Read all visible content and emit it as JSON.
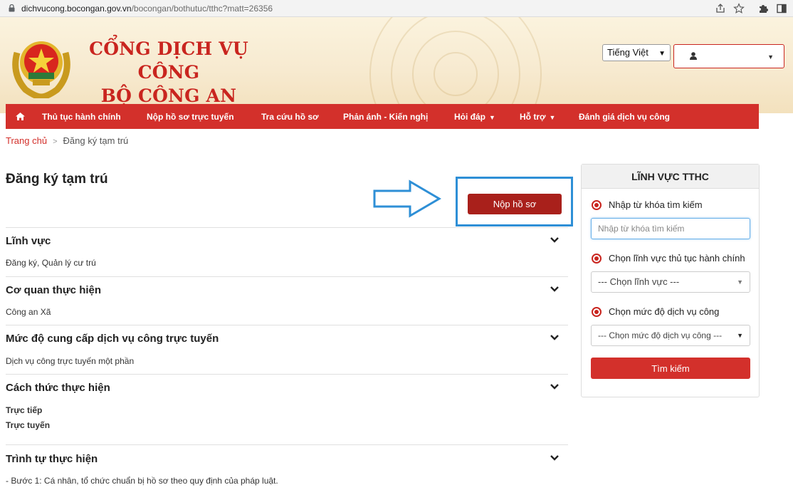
{
  "browser": {
    "url_domain": "dichvucong.bocongan.gov.vn",
    "url_path": "/bocongan/bothutuc/tthc?matt=26356"
  },
  "header": {
    "title_line1": "CỔNG DỊCH VỤ CÔNG",
    "title_line2": "BỘ CÔNG AN",
    "language": "Tiếng Việt"
  },
  "nav": {
    "items": [
      "Thủ tục hành chính",
      "Nộp hồ sơ trực tuyến",
      "Tra cứu hồ sơ",
      "Phản ánh - Kiến nghị",
      "Hỏi đáp",
      "Hỗ trợ",
      "Đánh giá dịch vụ công"
    ]
  },
  "breadcrumb": {
    "home": "Trang chủ",
    "separator": ">",
    "current": "Đăng ký tạm trú"
  },
  "main": {
    "title": "Đăng ký tạm trú",
    "submit_label": "Nộp hồ sơ",
    "sections": [
      {
        "title": "Lĩnh vực",
        "body": [
          "Đăng ký, Quản lý cư trú"
        ]
      },
      {
        "title": "Cơ quan thực hiện",
        "body": [
          "Công an Xã"
        ]
      },
      {
        "title": "Mức độ cung cấp dịch vụ công trực tuyến",
        "body": [
          "Dịch vụ công trực tuyến một phần"
        ]
      },
      {
        "title": "Cách thức thực hiện",
        "body": [
          "Trực tiếp",
          "Trực tuyến"
        ]
      },
      {
        "title": "Trình tự thực hiện",
        "body": [
          "- Bước 1: Cá nhân, tổ chức chuẩn bị hồ sơ theo quy định của pháp luật."
        ]
      }
    ]
  },
  "sidebar": {
    "heading": "LĨNH VỰC TTHC",
    "keyword_label": "Nhập từ khóa tìm kiếm",
    "keyword_placeholder": "Nhập từ khóa tìm kiếm",
    "field_label": "Chọn lĩnh vực thủ tục hành chính",
    "field_select": "--- Chọn lĩnh vực ---",
    "level_label": "Chọn mức độ dịch vụ công",
    "level_select": "--- Chọn mức độ dịch vụ công ---",
    "search_label": "Tìm kiếm"
  },
  "colors": {
    "brand_red": "#d3302b",
    "button_dark_red": "#a9201b",
    "highlight_blue": "#2e8fd6"
  }
}
